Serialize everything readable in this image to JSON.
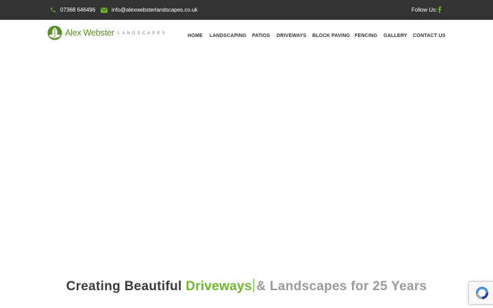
{
  "topbar": {
    "phone": "07368 646496",
    "email": "info@alexwebsterlandscapes.co.uk",
    "follow_label": "Follow Us:",
    "icons": {
      "phone": "phone-icon",
      "email": "envelope-icon",
      "social": "facebook-icon"
    }
  },
  "logo": {
    "name": "Alex Webster",
    "sub": "LANDSCAPES"
  },
  "nav": {
    "items": [
      {
        "label": "HOME"
      },
      {
        "label": "LANDSCAPING"
      },
      {
        "label": "PATIOS"
      },
      {
        "label": "DRIVEWAYS"
      },
      {
        "label": "BLOCK PAVING"
      },
      {
        "label": "FENCING"
      },
      {
        "label": "GALLERY"
      },
      {
        "label": "CONTACT US"
      }
    ]
  },
  "hero": {
    "tagline_prefix": "Creating Beautiful",
    "tagline_highlight": "Driveways",
    "tagline_suffix": "& Landscapes for 25 Years"
  },
  "colors": {
    "topbar_bg": "#333333",
    "accent_green": "#6cb62e",
    "nav_text": "#333333",
    "tagline_dark": "#3a3a3a",
    "tagline_grey": "#9a9a9a"
  }
}
